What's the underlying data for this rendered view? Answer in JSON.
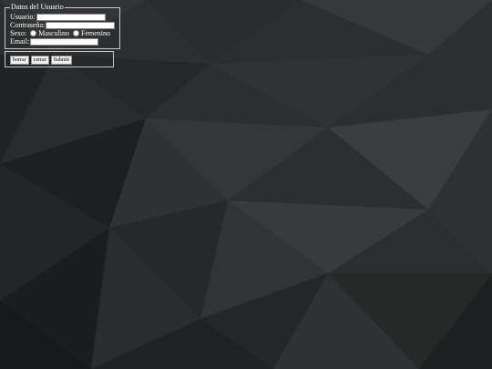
{
  "form": {
    "legend": "Datos del Usuario",
    "usuario_label": "Usuario:",
    "usuario_value": "",
    "contrasena_label": "Contraseña:",
    "contrasena_value": "",
    "sexo_label": "Sexo:",
    "sexo_options": [
      "Masculino",
      "Femenino"
    ],
    "email_label": "Email:",
    "email_value": ""
  },
  "buttons": {
    "borrar": "borrar",
    "cerrar": "cerrar",
    "submit": "Submit"
  }
}
